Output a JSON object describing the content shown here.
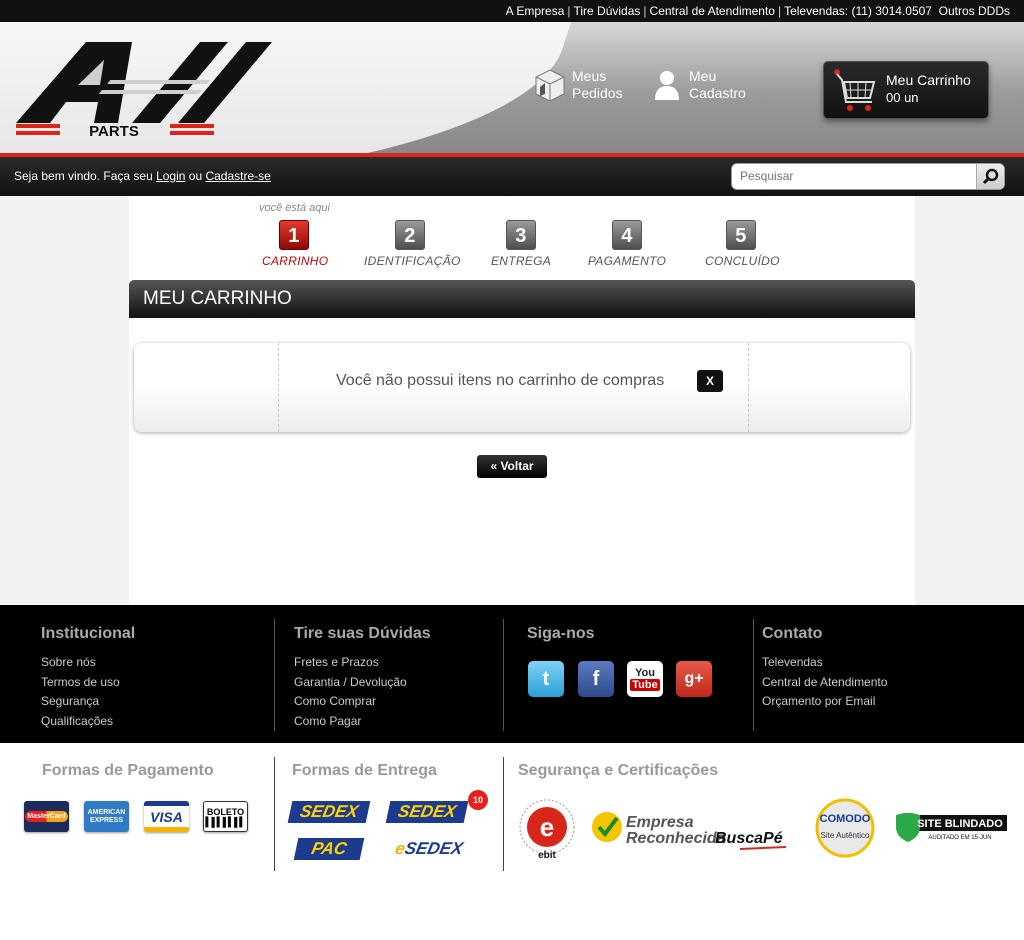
{
  "topbar": {
    "links": [
      "A Empresa",
      "Tire Dúvidas",
      "Central de Atendimento",
      "Televendas: (11) 3014.0507",
      "Outros DDDs"
    ]
  },
  "header": {
    "logo_main": "All",
    "logo_sub": "PARTS",
    "orders": {
      "line1": "Meus",
      "line2": "Pedidos"
    },
    "account": {
      "line1": "Meu",
      "line2": "Cadastro"
    },
    "cart": {
      "title": "Meu Carrinho",
      "count": "00 un"
    }
  },
  "welcome": {
    "prefix": "Seja bem vindo. Faça seu ",
    "login": "Login",
    "or": " ou ",
    "signup": "Cadastre-se"
  },
  "search": {
    "placeholder": "Pesquisar"
  },
  "steps": {
    "here": "você está aqui",
    "items": [
      {
        "num": "1",
        "label": "CARRINHO"
      },
      {
        "num": "2",
        "label": "IDENTIFICAÇÃO"
      },
      {
        "num": "3",
        "label": "ENTREGA"
      },
      {
        "num": "4",
        "label": "PAGAMENTO"
      },
      {
        "num": "5",
        "label": "CONCLUÍDO"
      }
    ]
  },
  "cart_page": {
    "title": "MEU CARRINHO",
    "empty_message": "Você não possui itens no carrinho de compras",
    "close": "X",
    "back": "« Voltar"
  },
  "footer": {
    "institucional": {
      "title": "Institucional",
      "items": [
        "Sobre nós",
        "Termos de uso",
        "Segurança",
        "Qualificações"
      ]
    },
    "duvidas": {
      "title": "Tire suas Dúvidas",
      "items": [
        "Fretes e Prazos",
        "Garantia / Devolução",
        "Como Comprar",
        "Como Pagar"
      ]
    },
    "siga": {
      "title": "Siga-nos",
      "icons": [
        "twitter-icon",
        "facebook-icon",
        "youtube-icon",
        "google-plus-icon"
      ]
    },
    "contato": {
      "title": "Contato",
      "items": [
        "Televendas",
        "Central de Atendimento",
        "Orçamento por Email"
      ]
    }
  },
  "bottom": {
    "pagamento": {
      "title": "Formas de Pagamento",
      "cards": [
        "MasterCard",
        "AMERICAN EXPRESS",
        "VISA",
        "BOLETO"
      ]
    },
    "entrega": {
      "title": "Formas de Entrega",
      "options": [
        "SEDEX",
        "SEDEX",
        "PAC",
        "SEDEX"
      ],
      "badge": "10"
    },
    "seguranca": {
      "title": "Segurança e Certificações",
      "ebit": "ebit",
      "buscape_line1": "Empresa",
      "buscape_line2": "Reconhecida",
      "buscape_brand": "BuscaPé",
      "comodo": "COMODO",
      "comodo_sub": "Site Autêntico",
      "blindado": "SITE BLINDADO",
      "blindado_sub": "AUDITADO EM 15-JUN"
    }
  }
}
